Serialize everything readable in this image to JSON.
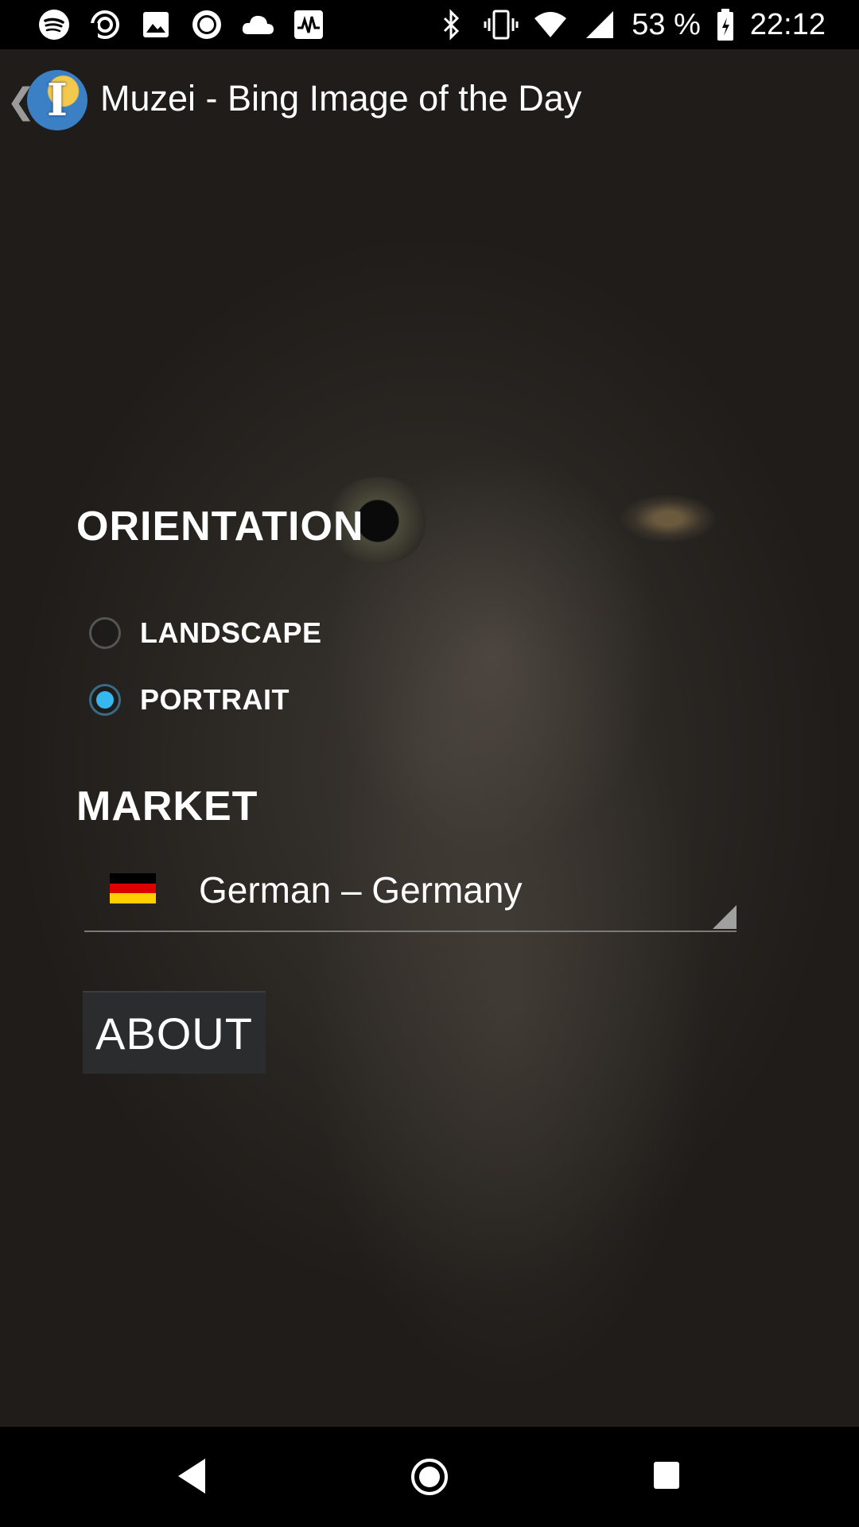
{
  "status_bar": {
    "battery": "53 %",
    "time": "22:12",
    "left_icons": [
      "spotify-icon",
      "sync-icon",
      "image-icon",
      "radio-icon",
      "cloud-icon",
      "activity-icon"
    ],
    "right_icons": [
      "bluetooth-icon",
      "vibrate-icon",
      "wifi-icon",
      "signal-icon",
      "battery-icon"
    ]
  },
  "app_bar": {
    "title": "Muzei - Bing Image of the Day",
    "back_icon": "chevron-left-icon",
    "logo_letter": "I"
  },
  "orientation": {
    "title": "ORIENTATION",
    "options": [
      {
        "label": "LANDSCAPE",
        "checked": false
      },
      {
        "label": "PORTRAIT",
        "checked": true
      }
    ]
  },
  "market": {
    "title": "MARKET",
    "selected": "German – Germany",
    "flag": "germany-flag-icon",
    "flag_colors": [
      "#000000",
      "#dd0000",
      "#ffce00"
    ]
  },
  "about_button": {
    "label": "ABOUT"
  },
  "nav_bar": {
    "icons": [
      "back-icon",
      "home-icon",
      "recents-icon"
    ]
  },
  "colors": {
    "radio_accent": "#35b8f0",
    "background": "#2a2622"
  }
}
